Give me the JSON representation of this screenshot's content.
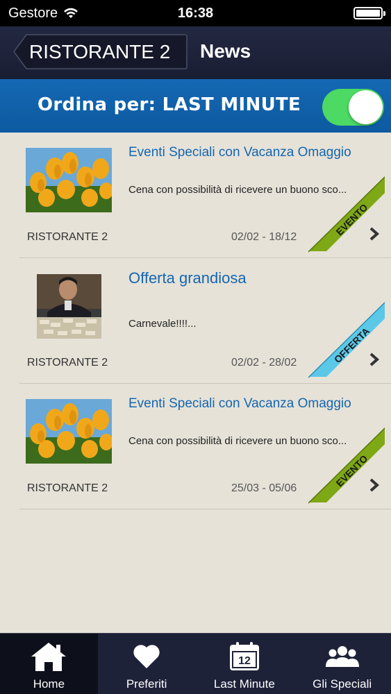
{
  "status_bar": {
    "carrier": "Gestore",
    "time": "16:38"
  },
  "nav": {
    "back_label": "RISTORANTE 2",
    "title": "News"
  },
  "sort": {
    "label": "Ordina per: LAST MINUTE",
    "toggle_on": true
  },
  "items": [
    {
      "title": "Eventi Speciali con Vacanza Omaggio",
      "description": "Cena con possibilità di ricevere un buono sco...",
      "source": "RISTORANTE 2",
      "dates": "02/02 - 18/12",
      "ribbon": "EVENTO",
      "ribbon_color": "#7ea815",
      "image": "tulips-image"
    },
    {
      "title": "Offerta grandiosa",
      "description": "Carnevale!!!!...",
      "source": "RISTORANTE 2",
      "dates": "02/02 - 28/02",
      "ribbon": "OFFERTA",
      "ribbon_color": "#5bc8e8",
      "image": "money-man-image"
    },
    {
      "title": "Eventi Speciali con Vacanza Omaggio",
      "description": "Cena con possibilità di ricevere un buono sco...",
      "source": "RISTORANTE 2",
      "dates": "25/03 - 05/06",
      "ribbon": "EVENTO",
      "ribbon_color": "#7ea815",
      "image": "tulips-image"
    }
  ],
  "tabs": [
    {
      "label": "Home",
      "icon": "home-icon",
      "active": true
    },
    {
      "label": "Preferiti",
      "icon": "heart-icon",
      "active": false
    },
    {
      "label": "Last Minute",
      "icon": "calendar-icon",
      "calendar_day": "12",
      "active": false
    },
    {
      "label": "Gli Speciali",
      "icon": "group-icon",
      "active": false
    }
  ],
  "colors": {
    "accent": "#1566b0",
    "nav_bg": "#1e2238",
    "toggle_on": "#4cd964"
  }
}
